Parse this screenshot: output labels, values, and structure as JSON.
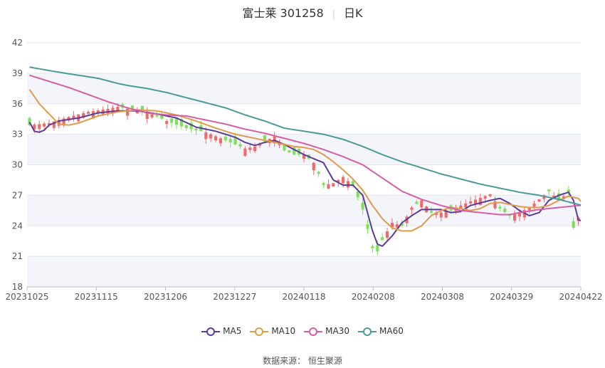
{
  "header": {
    "name": "富士莱 301258",
    "period": "日K"
  },
  "source": "数据来源： 恒生聚源",
  "colors": {
    "up": "#f06a6a",
    "down": "#7ee05a",
    "grid": "#e3e6ee",
    "band": "#f4f5fa"
  },
  "chart_data": {
    "type": "candlestick",
    "ylim": [
      18,
      42
    ],
    "yticks": [
      18,
      21,
      24,
      27,
      30,
      33,
      36,
      39,
      42
    ],
    "xticks": [
      "20231025",
      "20231115",
      "20231206",
      "20231227",
      "20240118",
      "20240208",
      "20240308",
      "20240329",
      "20240422"
    ],
    "xtick_index": [
      0,
      14,
      28,
      42,
      56,
      70,
      84,
      98,
      112
    ],
    "n_points": 113,
    "series": [
      {
        "name": "MA5",
        "color": "#5b3b97",
        "knots": [
          [
            0,
            34.2
          ],
          [
            1,
            33.3
          ],
          [
            2,
            33.2
          ],
          [
            3,
            33.4
          ],
          [
            4,
            33.9
          ],
          [
            6,
            34.3
          ],
          [
            10,
            34.6
          ],
          [
            14,
            35.1
          ],
          [
            18,
            35.3
          ],
          [
            22,
            35.3
          ],
          [
            26,
            35.0
          ],
          [
            30,
            34.6
          ],
          [
            34,
            33.7
          ],
          [
            38,
            33.3
          ],
          [
            42,
            32.7
          ],
          [
            44,
            32.2
          ],
          [
            46,
            31.9
          ],
          [
            48,
            32.2
          ],
          [
            50,
            32.4
          ],
          [
            52,
            32.0
          ],
          [
            54,
            31.5
          ],
          [
            56,
            31.0
          ],
          [
            60,
            30.2
          ],
          [
            62,
            28.5
          ],
          [
            64,
            28.0
          ],
          [
            66,
            28.0
          ],
          [
            68,
            27.0
          ],
          [
            70,
            23.5
          ],
          [
            71,
            22.2
          ],
          [
            72,
            22.0
          ],
          [
            74,
            23.0
          ],
          [
            76,
            24.3
          ],
          [
            78,
            25.0
          ],
          [
            80,
            25.6
          ],
          [
            84,
            25.6
          ],
          [
            86,
            25.3
          ],
          [
            88,
            25.4
          ],
          [
            90,
            26.0
          ],
          [
            94,
            26.5
          ],
          [
            96,
            26.7
          ],
          [
            98,
            26.2
          ],
          [
            100,
            25.5
          ],
          [
            102,
            25.0
          ],
          [
            104,
            25.3
          ],
          [
            106,
            26.5
          ],
          [
            108,
            27.0
          ],
          [
            110,
            27.3
          ],
          [
            111,
            26.5
          ],
          [
            112,
            24.6
          ],
          [
            113,
            24.4
          ]
        ]
      },
      {
        "name": "MA10",
        "color": "#e09a4c",
        "knots": [
          [
            0,
            37.4
          ],
          [
            2,
            36.0
          ],
          [
            4,
            35.0
          ],
          [
            6,
            34.0
          ],
          [
            8,
            33.9
          ],
          [
            10,
            34.1
          ],
          [
            14,
            34.8
          ],
          [
            18,
            35.2
          ],
          [
            22,
            35.4
          ],
          [
            26,
            35.3
          ],
          [
            30,
            34.9
          ],
          [
            34,
            34.3
          ],
          [
            38,
            33.6
          ],
          [
            42,
            33.0
          ],
          [
            46,
            32.6
          ],
          [
            50,
            32.2
          ],
          [
            54,
            31.8
          ],
          [
            56,
            31.7
          ],
          [
            58,
            31.5
          ],
          [
            60,
            31.0
          ],
          [
            62,
            30.3
          ],
          [
            64,
            29.5
          ],
          [
            66,
            28.6
          ],
          [
            68,
            27.5
          ],
          [
            70,
            26.0
          ],
          [
            72,
            24.7
          ],
          [
            74,
            23.8
          ],
          [
            76,
            23.5
          ],
          [
            78,
            23.5
          ],
          [
            80,
            24.0
          ],
          [
            82,
            25.0
          ],
          [
            84,
            25.5
          ],
          [
            86,
            25.8
          ],
          [
            88,
            25.7
          ],
          [
            90,
            25.5
          ],
          [
            92,
            25.7
          ],
          [
            94,
            26.2
          ],
          [
            96,
            26.3
          ],
          [
            98,
            26.1
          ],
          [
            100,
            25.9
          ],
          [
            102,
            25.8
          ],
          [
            104,
            25.8
          ],
          [
            106,
            26.0
          ],
          [
            108,
            26.5
          ],
          [
            110,
            26.9
          ],
          [
            112,
            26.7
          ],
          [
            113,
            26.1
          ]
        ]
      },
      {
        "name": "MA30",
        "color": "#d55ea6",
        "knots": [
          [
            0,
            38.8
          ],
          [
            4,
            38.2
          ],
          [
            8,
            37.6
          ],
          [
            12,
            36.9
          ],
          [
            16,
            36.2
          ],
          [
            20,
            35.6
          ],
          [
            24,
            35.1
          ],
          [
            28,
            34.9
          ],
          [
            32,
            34.8
          ],
          [
            36,
            34.4
          ],
          [
            40,
            34.0
          ],
          [
            44,
            33.5
          ],
          [
            48,
            33.1
          ],
          [
            52,
            32.6
          ],
          [
            56,
            32.1
          ],
          [
            60,
            31.5
          ],
          [
            64,
            30.8
          ],
          [
            68,
            30.0
          ],
          [
            72,
            28.7
          ],
          [
            76,
            27.4
          ],
          [
            80,
            26.6
          ],
          [
            84,
            26.0
          ],
          [
            88,
            25.5
          ],
          [
            92,
            25.3
          ],
          [
            96,
            25.1
          ],
          [
            98,
            25.1
          ],
          [
            100,
            25.3
          ],
          [
            104,
            25.6
          ],
          [
            108,
            25.8
          ],
          [
            112,
            26.0
          ],
          [
            113,
            26.0
          ]
        ]
      },
      {
        "name": "MA60",
        "color": "#4a9a9b",
        "knots": [
          [
            0,
            39.6
          ],
          [
            6,
            39.1
          ],
          [
            10,
            38.8
          ],
          [
            14,
            38.5
          ],
          [
            18,
            38.0
          ],
          [
            20,
            37.8
          ],
          [
            24,
            37.5
          ],
          [
            28,
            37.1
          ],
          [
            32,
            36.6
          ],
          [
            36,
            36.1
          ],
          [
            40,
            35.6
          ],
          [
            44,
            34.9
          ],
          [
            48,
            34.3
          ],
          [
            52,
            33.6
          ],
          [
            56,
            33.3
          ],
          [
            60,
            33.0
          ],
          [
            64,
            32.5
          ],
          [
            68,
            31.8
          ],
          [
            72,
            31.0
          ],
          [
            76,
            30.3
          ],
          [
            80,
            29.7
          ],
          [
            84,
            29.1
          ],
          [
            88,
            28.6
          ],
          [
            92,
            28.1
          ],
          [
            96,
            27.7
          ],
          [
            100,
            27.3
          ],
          [
            104,
            27.0
          ],
          [
            108,
            26.6
          ],
          [
            112,
            26.1
          ],
          [
            113,
            26.0
          ]
        ]
      }
    ],
    "candle_guide": [
      [
        0,
        33.9
      ],
      [
        4,
        34.1
      ],
      [
        8,
        34.7
      ],
      [
        12,
        35.2
      ],
      [
        16,
        35.5
      ],
      [
        18,
        35.7
      ],
      [
        20,
        35.5
      ],
      [
        24,
        35.2
      ],
      [
        28,
        34.3
      ],
      [
        32,
        33.6
      ],
      [
        36,
        33.2
      ],
      [
        40,
        32.4
      ],
      [
        44,
        31.6
      ],
      [
        46,
        31.8
      ],
      [
        48,
        32.3
      ],
      [
        50,
        32.8
      ],
      [
        52,
        31.4
      ],
      [
        54,
        31.0
      ],
      [
        56,
        31.0
      ],
      [
        58,
        30.2
      ],
      [
        60,
        28.0
      ],
      [
        62,
        28.2
      ],
      [
        64,
        28.8
      ],
      [
        66,
        28.0
      ],
      [
        68,
        25.6
      ],
      [
        70,
        21.8
      ],
      [
        71,
        21.5
      ],
      [
        72,
        22.6
      ],
      [
        74,
        24.3
      ],
      [
        76,
        24.0
      ],
      [
        78,
        25.8
      ],
      [
        80,
        26.5
      ],
      [
        82,
        25.3
      ],
      [
        84,
        25.3
      ],
      [
        86,
        25.5
      ],
      [
        88,
        26.0
      ],
      [
        90,
        26.4
      ],
      [
        94,
        27.1
      ],
      [
        96,
        25.7
      ],
      [
        98,
        25.0
      ],
      [
        100,
        25.3
      ],
      [
        102,
        25.8
      ],
      [
        104,
        26.6
      ],
      [
        106,
        27.4
      ],
      [
        108,
        26.5
      ],
      [
        110,
        27.3
      ],
      [
        111,
        23.8
      ],
      [
        112,
        24.8
      ],
      [
        113,
        24.6
      ]
    ]
  }
}
